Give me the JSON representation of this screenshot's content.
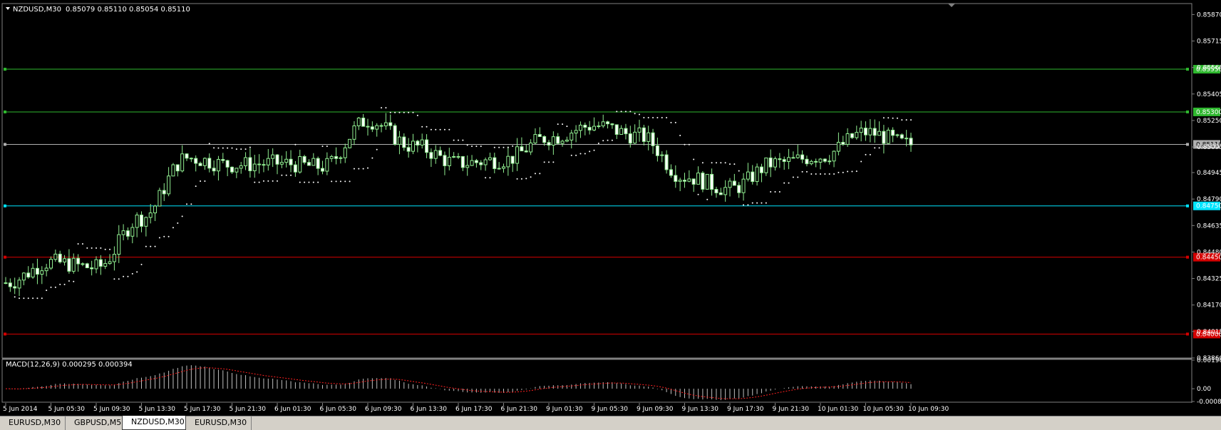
{
  "main_chart": {
    "header": "NZDUSD,M30  0.85079 0.85110 0.85054 0.85110",
    "symbol": "NZDUSD,M30",
    "ohlc": "0.85079 0.85110 0.85054 0.85110",
    "current_price": 0.8511,
    "current_price_label": "0.85110",
    "price_scale_labels": [
      "0.85870",
      "0.85715",
      "0.85560",
      "0.85405",
      "0.85250",
      "0.85095",
      "0.84945",
      "0.84790",
      "0.84635",
      "0.84480",
      "0.84325",
      "0.84170",
      "0.84015",
      "0.83860"
    ],
    "horizontal_lines": [
      {
        "price": 0.8555,
        "label": "0.85550",
        "color": "#2fb82f"
      },
      {
        "price": 0.853,
        "label": "0.85300",
        "color": "#2fb82f"
      },
      {
        "price": 0.8511,
        "label": "0.85110",
        "color": "#b0b0b0"
      },
      {
        "price": 0.8475,
        "label": "0.84750",
        "color": "#00e5ff"
      },
      {
        "price": 0.8445,
        "label": "0.84450",
        "color": "#d40000"
      },
      {
        "price": 0.84,
        "label": "0.84000",
        "color": "#d40000"
      }
    ]
  },
  "chart_data": {
    "type": "line",
    "x_labels": [
      "5 Jun 2014",
      "5 Jun 05:30",
      "5 Jun 09:30",
      "5 Jun 13:30",
      "5 Jun 17:30",
      "5 Jun 21:30",
      "6 Jun 01:30",
      "6 Jun 05:30",
      "6 Jun 09:30",
      "6 Jun 13:30",
      "6 Jun 17:30",
      "6 Jun 21:30",
      "9 Jun 01:30",
      "9 Jun 05:30",
      "9 Jun 09:30",
      "9 Jun 13:30",
      "9 Jun 17:30",
      "9 Jun 21:30",
      "10 Jun 01:30",
      "10 Jun 05:30",
      "10 Jun 09:30"
    ],
    "close_series": [
      {
        "time": "5 Jun 2014",
        "close": 0.843
      },
      {
        "time": "5 Jun 05:30",
        "close": 0.8442
      },
      {
        "time": "5 Jun 09:30",
        "close": 0.8439
      },
      {
        "time": "5 Jun 13:30",
        "close": 0.8468
      },
      {
        "time": "5 Jun 17:30",
        "close": 0.8503
      },
      {
        "time": "5 Jun 21:30",
        "close": 0.8499
      },
      {
        "time": "6 Jun 01:30",
        "close": 0.85
      },
      {
        "time": "6 Jun 05:30",
        "close": 0.8498
      },
      {
        "time": "6 Jun 09:30",
        "close": 0.8525
      },
      {
        "time": "6 Jun 13:30",
        "close": 0.851
      },
      {
        "time": "6 Jun 17:30",
        "close": 0.85
      },
      {
        "time": "6 Jun 21:30",
        "close": 0.8502
      },
      {
        "time": "9 Jun 01:30",
        "close": 0.8515
      },
      {
        "time": "9 Jun 05:30",
        "close": 0.8522
      },
      {
        "time": "9 Jun 09:30",
        "close": 0.8516
      },
      {
        "time": "9 Jun 13:30",
        "close": 0.8492
      },
      {
        "time": "9 Jun 17:30",
        "close": 0.8485
      },
      {
        "time": "9 Jun 21:30",
        "close": 0.85
      },
      {
        "time": "10 Jun 01:30",
        "close": 0.8504
      },
      {
        "time": "10 Jun 05:30",
        "close": 0.8518
      },
      {
        "time": "10 Jun 09:30",
        "close": 0.8511
      }
    ],
    "y_range": [
      0.8386,
      0.8593
    ]
  },
  "macd_panel": {
    "label": "MACD(12,26,9) 0.000295 0.000394",
    "scale_labels": [
      "0.001907",
      "0.00",
      "-0.000852"
    ],
    "y_range": [
      -0.000852,
      0.001907
    ]
  },
  "tabs": [
    {
      "label": "EURUSD,M30",
      "active": false
    },
    {
      "label": "GBPUSD,M5",
      "active": false
    },
    {
      "label": "NZDUSD,M30",
      "active": true
    },
    {
      "label": "EURUSD,M30",
      "active": false
    }
  ],
  "colors": {
    "background": "#000000",
    "foreground": "#ffffff",
    "candle_bull": "#90ee90",
    "candle_bear": "#ffffff",
    "psar": "#ffffff",
    "macd_histogram": "#c0c0c0",
    "macd_signal": "#ff2020"
  }
}
